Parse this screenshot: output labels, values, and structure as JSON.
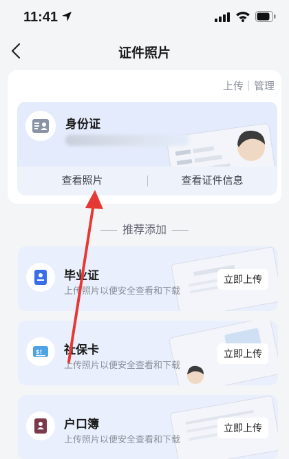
{
  "status_bar": {
    "time": "11:41",
    "icons": [
      "location-arrow-icon",
      "signal-icon",
      "wifi-icon",
      "battery-icon"
    ]
  },
  "nav": {
    "title": "证件照片",
    "back_icon": "chevron-left-icon"
  },
  "top_actions": {
    "upload": "上传",
    "manage": "管理"
  },
  "id_card": {
    "title": "身份证",
    "icon": "id-card-icon",
    "buttons": {
      "view_photo": "查看照片",
      "view_info": "查看证件信息"
    }
  },
  "section": {
    "title": "推荐添加"
  },
  "recommend": [
    {
      "title": "毕业证",
      "subtitle": "上传照片以便安全查看和下载",
      "button": "立即上传",
      "icon": "diploma-icon",
      "icon_color": "#3a6ee8"
    },
    {
      "title": "社保卡",
      "subtitle": "上传照片以便安全查看和下载",
      "button": "立即上传",
      "icon": "social-security-card-icon",
      "icon_color": "#4da3e6"
    },
    {
      "title": "户口簿",
      "subtitle": "上传照片以便安全查看和下载",
      "button": "立即上传",
      "icon": "household-register-icon",
      "icon_color": "#7a3a4a"
    }
  ],
  "colors": {
    "accent_red": "#e53935",
    "card_bg": "#e9effc",
    "page_bg": "#f4f5f7"
  }
}
